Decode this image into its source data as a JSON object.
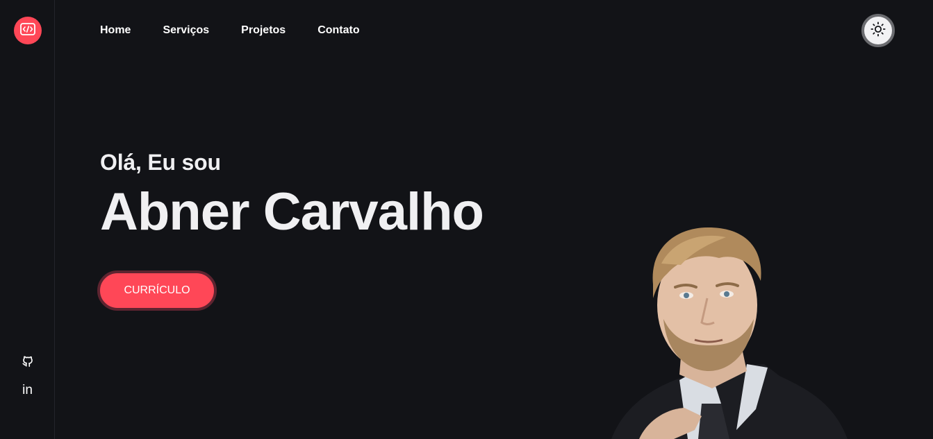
{
  "sidebar": {
    "logo_icon": "code-brackets-icon",
    "social": [
      {
        "icon": "github-icon"
      },
      {
        "icon": "linkedin-icon",
        "label": "in"
      }
    ]
  },
  "nav": {
    "items": [
      {
        "label": "Home"
      },
      {
        "label": "Serviços"
      },
      {
        "label": "Projetos"
      },
      {
        "label": "Contato"
      }
    ]
  },
  "theme_toggle": {
    "icon": "sun-icon"
  },
  "hero": {
    "greeting": "Olá, Eu sou",
    "name": "Abner Carvalho",
    "cv_button": "CURRÍCULO"
  },
  "colors": {
    "background": "#121317",
    "accent": "#ff4757",
    "text": "#f0f0f2"
  }
}
